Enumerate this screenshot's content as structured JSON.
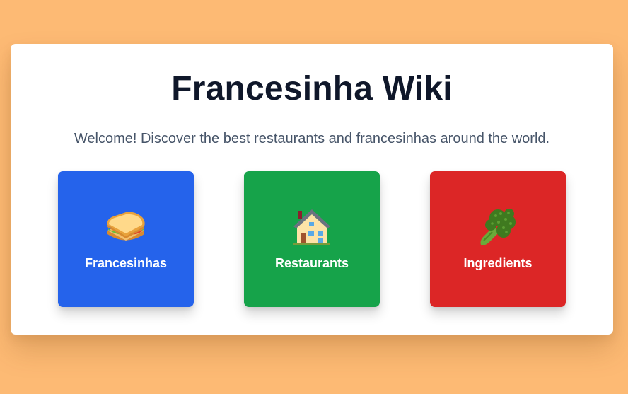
{
  "page": {
    "title": "Francesinha Wiki",
    "subtitle": "Welcome! Discover the best restaurants and francesinhas around the world.",
    "background_color": "#fdba74"
  },
  "tiles": [
    {
      "label": "Francesinhas",
      "icon": "sandwich-icon",
      "color": "#2563eb"
    },
    {
      "label": "Restaurants",
      "icon": "house-icon",
      "color": "#16a34a"
    },
    {
      "label": "Ingredients",
      "icon": "broccoli-icon",
      "color": "#dc2626"
    }
  ]
}
